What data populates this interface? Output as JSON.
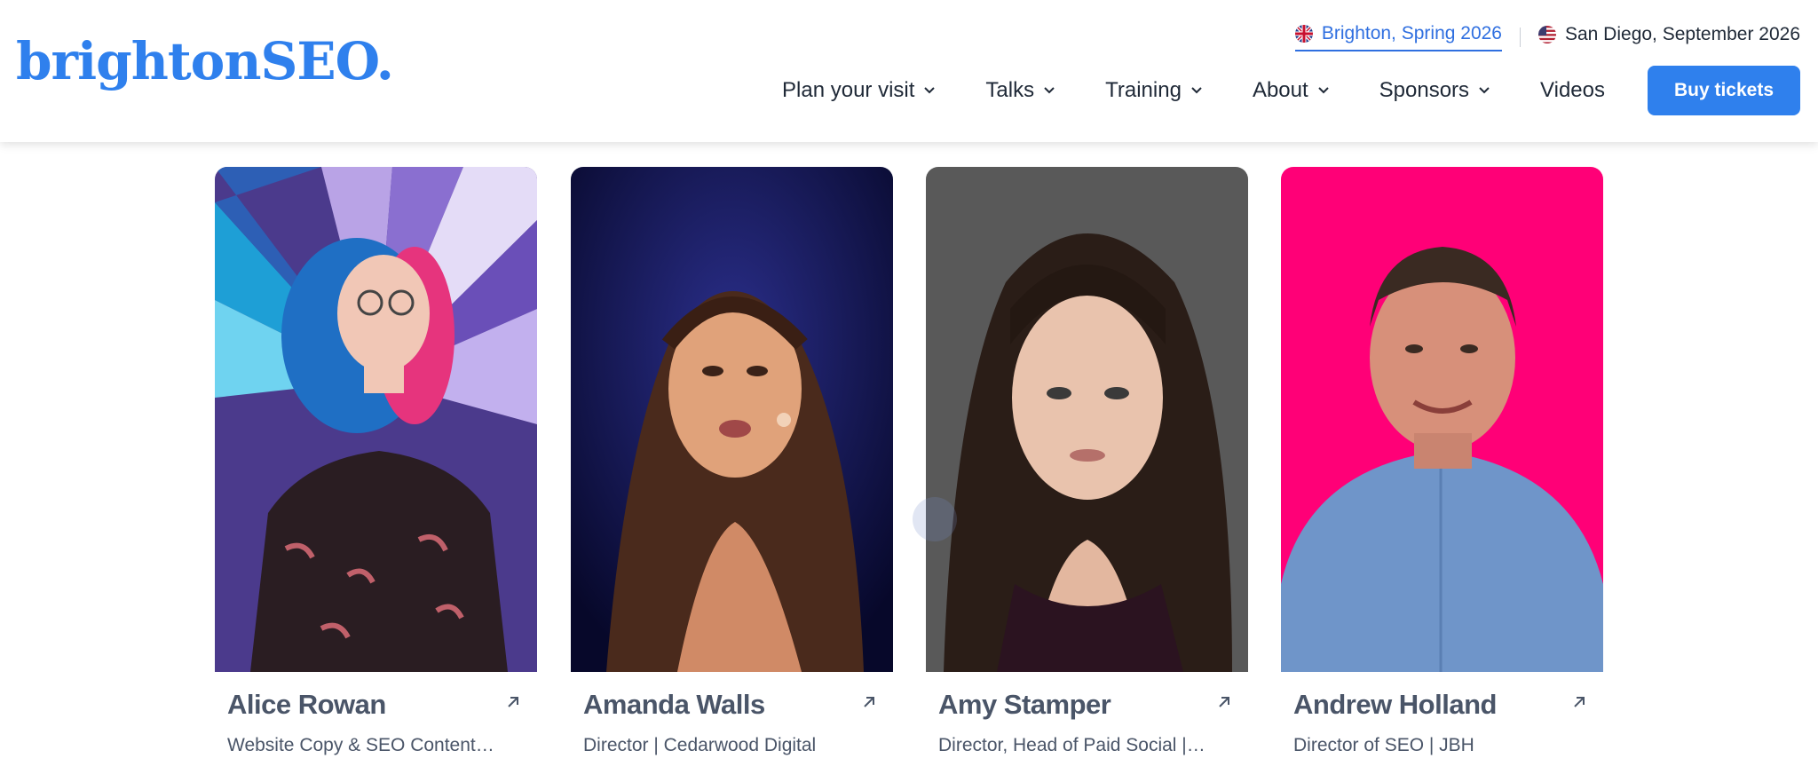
{
  "brand": {
    "logo_text": "brightonSEO.",
    "accent_color": "#2f80ed"
  },
  "header": {
    "locations": [
      {
        "label": "Brighton, Spring 2026",
        "flag": "uk-flag-icon",
        "active": true
      },
      {
        "label": "San Diego, September 2026",
        "flag": "us-flag-icon",
        "active": false
      }
    ],
    "nav": [
      {
        "label": "Plan your visit",
        "has_dropdown": true
      },
      {
        "label": "Talks",
        "has_dropdown": true
      },
      {
        "label": "Training",
        "has_dropdown": true
      },
      {
        "label": "About",
        "has_dropdown": true
      },
      {
        "label": "Sponsors",
        "has_dropdown": true
      },
      {
        "label": "Videos",
        "has_dropdown": false
      }
    ],
    "cta_label": "Buy tickets"
  },
  "speakers": [
    {
      "name": "Alice Rowan",
      "role": "Website Copy & SEO Content…",
      "photo_bg": "#5a3fa0"
    },
    {
      "name": "Amanda Walls",
      "role": "Director | Cedarwood Digital",
      "photo_bg": "#0d0f3a"
    },
    {
      "name": "Amy Stamper",
      "role": "Director, Head of Paid Social |…",
      "photo_bg": "#575757"
    },
    {
      "name": "Andrew Holland",
      "role": "Director of SEO | JBH",
      "photo_bg": "#ff0077"
    }
  ]
}
